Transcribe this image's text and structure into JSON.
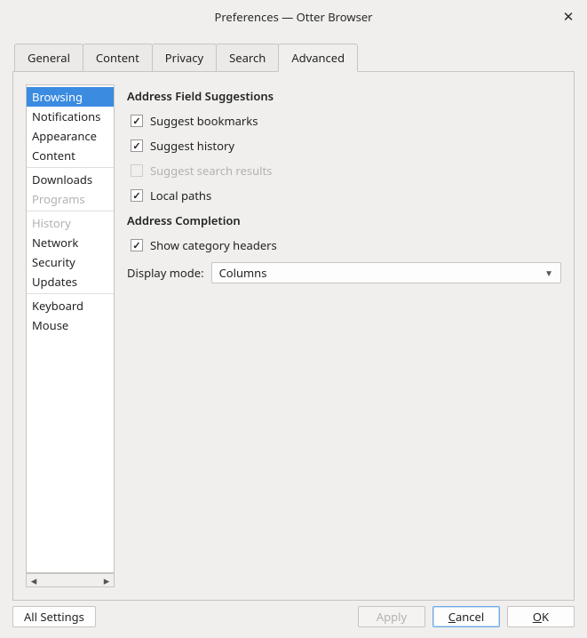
{
  "window": {
    "title": "Preferences — Otter Browser"
  },
  "tabs": [
    {
      "label": "General"
    },
    {
      "label": "Content"
    },
    {
      "label": "Privacy"
    },
    {
      "label": "Search"
    },
    {
      "label": "Advanced",
      "active": true
    }
  ],
  "sidebar": {
    "groups": [
      [
        {
          "label": "Browsing",
          "selected": true
        },
        {
          "label": "Notifications"
        },
        {
          "label": "Appearance"
        },
        {
          "label": "Content"
        }
      ],
      [
        {
          "label": "Downloads"
        },
        {
          "label": "Programs",
          "disabled": true
        }
      ],
      [
        {
          "label": "History",
          "disabled": true
        },
        {
          "label": "Network"
        },
        {
          "label": "Security"
        },
        {
          "label": "Updates"
        }
      ],
      [
        {
          "label": "Keyboard"
        },
        {
          "label": "Mouse"
        }
      ]
    ]
  },
  "sections": {
    "address_suggestions": {
      "heading": "Address Field Suggestions",
      "items": [
        {
          "label": "Suggest bookmarks",
          "checked": true
        },
        {
          "label": "Suggest history",
          "checked": true
        },
        {
          "label": "Suggest search results",
          "checked": false,
          "disabled": true
        },
        {
          "label": "Local paths",
          "checked": true
        }
      ]
    },
    "address_completion": {
      "heading": "Address Completion",
      "show_category_headers": {
        "label": "Show category headers",
        "checked": true
      },
      "display_mode": {
        "label": "Display mode:",
        "value": "Columns"
      }
    }
  },
  "buttons": {
    "all_settings": "All Settings",
    "apply": "Apply",
    "cancel_prefix": "",
    "cancel_u": "C",
    "cancel_suffix": "ancel",
    "ok_prefix": "",
    "ok_u": "O",
    "ok_suffix": "K"
  }
}
